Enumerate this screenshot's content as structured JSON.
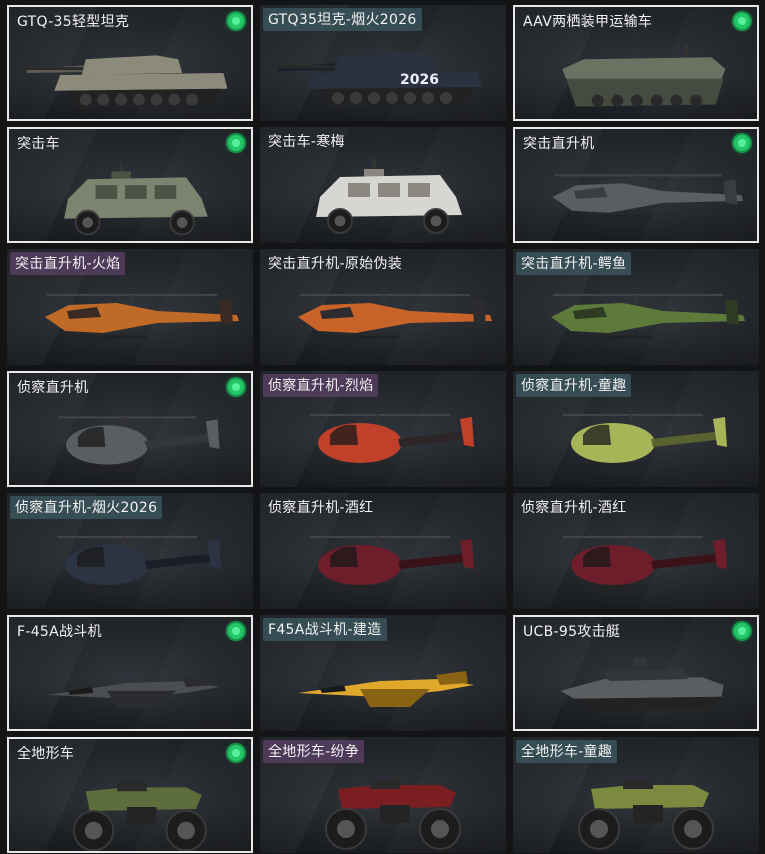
{
  "status_color": "#24c766",
  "cards": [
    {
      "label": "GTQ-35轻型坦克",
      "owned": true,
      "selected": true,
      "tint": "plain",
      "icon": "tank-icon",
      "kind": "tank",
      "c1": "#8c8a7a",
      "c2": "#5e5c52",
      "badge": ""
    },
    {
      "label": "GTQ35坦克-烟火2026",
      "owned": false,
      "selected": false,
      "tint": "teal",
      "icon": "tank-icon",
      "kind": "tank",
      "c1": "#2a3140",
      "c2": "#1a1f2a",
      "badge": "2026"
    },
    {
      "label": "AAV两栖装甲运输车",
      "owned": true,
      "selected": true,
      "tint": "plain",
      "icon": "amphibious-vehicle-icon",
      "kind": "aav",
      "c1": "#6a7262",
      "c2": "#454b40",
      "badge": ""
    },
    {
      "label": "突击车",
      "owned": true,
      "selected": true,
      "tint": "plain",
      "icon": "armored-car-icon",
      "kind": "car",
      "c1": "#7c8470",
      "c2": "#4c5244",
      "badge": ""
    },
    {
      "label": "突击车-寒梅",
      "owned": false,
      "selected": false,
      "tint": "plain",
      "icon": "armored-car-icon",
      "kind": "car",
      "c1": "#d8d6d2",
      "c2": "#8a8680",
      "badge": ""
    },
    {
      "label": "突击直升机",
      "owned": true,
      "selected": true,
      "tint": "plain",
      "icon": "attack-helicopter-icon",
      "kind": "apache",
      "c1": "#5a5e62",
      "c2": "#3a3d40",
      "badge": ""
    },
    {
      "label": "突击直升机-火焰",
      "owned": false,
      "selected": false,
      "tint": "purple",
      "icon": "attack-helicopter-icon",
      "kind": "apache",
      "c1": "#c06a28",
      "c2": "#3a2a24",
      "badge": ""
    },
    {
      "label": "突击直升机-原始伪装",
      "owned": false,
      "selected": false,
      "tint": "plain",
      "icon": "attack-helicopter-icon",
      "kind": "apache",
      "c1": "#c8632a",
      "c2": "#2c2c30",
      "badge": ""
    },
    {
      "label": "突击直升机-鳄鱼",
      "owned": false,
      "selected": false,
      "tint": "teal",
      "icon": "attack-helicopter-icon",
      "kind": "apache",
      "c1": "#5d7a3a",
      "c2": "#2e3a22",
      "badge": ""
    },
    {
      "label": "侦察直升机",
      "owned": true,
      "selected": true,
      "tint": "plain",
      "icon": "scout-helicopter-icon",
      "kind": "littlebird",
      "c1": "#5a5e62",
      "c2": "#33363a",
      "badge": ""
    },
    {
      "label": "侦察直升机-烈焰",
      "owned": false,
      "selected": false,
      "tint": "purple",
      "icon": "scout-helicopter-icon",
      "kind": "littlebird",
      "c1": "#c0402a",
      "c2": "#2c2628",
      "badge": ""
    },
    {
      "label": "侦察直升机-童趣",
      "owned": false,
      "selected": false,
      "tint": "teal",
      "icon": "scout-helicopter-icon",
      "kind": "littlebird",
      "c1": "#a7b458",
      "c2": "#5a6230",
      "badge": ""
    },
    {
      "label": "侦察直升机-烟火2026",
      "owned": false,
      "selected": false,
      "tint": "teal",
      "icon": "scout-helicopter-icon",
      "kind": "littlebird",
      "c1": "#2c3444",
      "c2": "#1a1e28",
      "badge": ""
    },
    {
      "label": "侦察直升机-酒红",
      "owned": false,
      "selected": false,
      "tint": "plain",
      "icon": "scout-helicopter-icon",
      "kind": "littlebird",
      "c1": "#6e1e2a",
      "c2": "#3a1218",
      "badge": ""
    },
    {
      "label": "侦察直升机-酒红",
      "owned": false,
      "selected": false,
      "tint": "plain",
      "icon": "scout-helicopter-icon",
      "kind": "littlebird",
      "c1": "#6e1e2a",
      "c2": "#3a1218",
      "badge": ""
    },
    {
      "label": "F-45A战斗机",
      "owned": true,
      "selected": true,
      "tint": "plain",
      "icon": "fighter-jet-icon",
      "kind": "jet",
      "c1": "#4a4d52",
      "c2": "#2a2c30",
      "badge": ""
    },
    {
      "label": "F45A战斗机-建造",
      "owned": false,
      "selected": false,
      "tint": "teal",
      "icon": "fighter-jet-icon",
      "kind": "jet",
      "c1": "#e0a82a",
      "c2": "#8a6214",
      "badge": ""
    },
    {
      "label": "UCB-95攻击艇",
      "owned": true,
      "selected": true,
      "tint": "plain",
      "icon": "attack-boat-icon",
      "kind": "boat",
      "c1": "#5a5e62",
      "c2": "#34373a",
      "badge": ""
    },
    {
      "label": "全地形车",
      "owned": true,
      "selected": true,
      "tint": "plain",
      "icon": "atv-icon",
      "kind": "atv",
      "c1": "#5d6e3c",
      "c2": "#2e2e2e",
      "badge": ""
    },
    {
      "label": "全地形车-纷争",
      "owned": false,
      "selected": false,
      "tint": "purple",
      "icon": "atv-icon",
      "kind": "atv",
      "c1": "#7a1e22",
      "c2": "#2a2a2a",
      "badge": ""
    },
    {
      "label": "全地形车-童趣",
      "owned": false,
      "selected": false,
      "tint": "teal",
      "icon": "atv-icon",
      "kind": "atv",
      "c1": "#7c8a40",
      "c2": "#2e2e2e",
      "badge": ""
    }
  ]
}
